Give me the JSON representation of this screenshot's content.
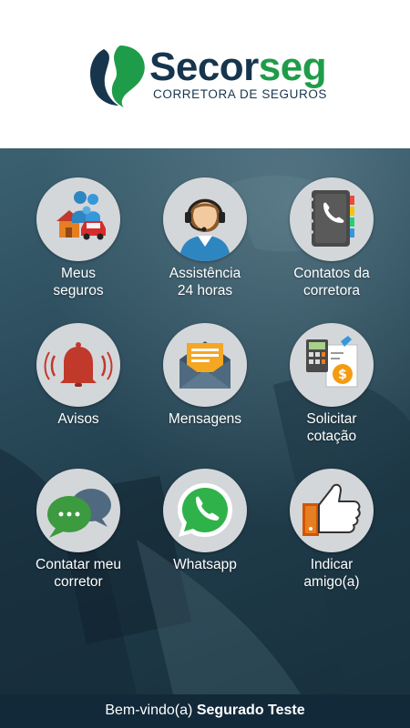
{
  "header": {
    "brand_part1": "Secor",
    "brand_part2": "seg",
    "tagline": "CORRETORA DE SEGUROS"
  },
  "menu": [
    {
      "label": "Meus\nseguros",
      "icon": "family-house-car-icon"
    },
    {
      "label": "Assistência\n24 horas",
      "icon": "headset-attendant-icon"
    },
    {
      "label": "Contatos da\ncorretora",
      "icon": "phone-book-icon"
    },
    {
      "label": "Avisos",
      "icon": "alarm-bell-icon"
    },
    {
      "label": "Mensagens",
      "icon": "envelope-icon"
    },
    {
      "label": "Solicitar\ncotação",
      "icon": "calculator-document-icon"
    },
    {
      "label": "Contatar meu\ncorretor",
      "icon": "chat-bubbles-icon"
    },
    {
      "label": "Whatsapp",
      "icon": "whatsapp-icon"
    },
    {
      "label": "Indicar\namigo(a)",
      "icon": "thumbs-up-icon"
    }
  ],
  "footer": {
    "greeting": "Bem-vindo(a)",
    "user_name": "Segurado Teste"
  },
  "colors": {
    "brand_dark": "#17364d",
    "brand_green": "#1f9c49",
    "icon_circle": "#d4d7da",
    "footer_bg": "#12293a"
  }
}
